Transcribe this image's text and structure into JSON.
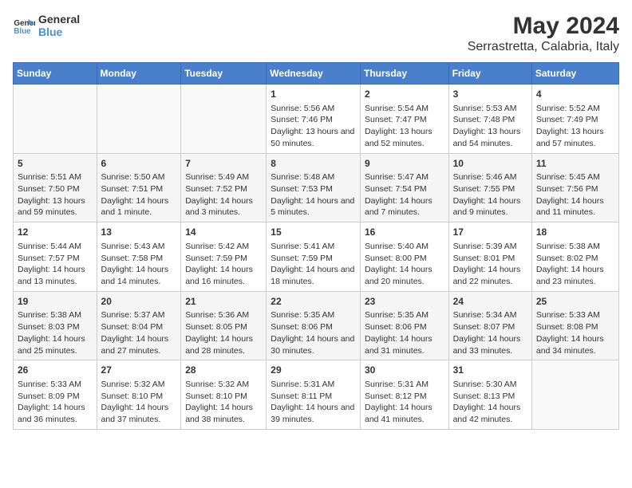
{
  "logo": {
    "line1": "General",
    "line2": "Blue"
  },
  "title": "May 2024",
  "subtitle": "Serrastretta, Calabria, Italy",
  "days_of_week": [
    "Sunday",
    "Monday",
    "Tuesday",
    "Wednesday",
    "Thursday",
    "Friday",
    "Saturday"
  ],
  "weeks": [
    [
      {
        "day": "",
        "sunrise": "",
        "sunset": "",
        "daylight": ""
      },
      {
        "day": "",
        "sunrise": "",
        "sunset": "",
        "daylight": ""
      },
      {
        "day": "",
        "sunrise": "",
        "sunset": "",
        "daylight": ""
      },
      {
        "day": "1",
        "sunrise": "Sunrise: 5:56 AM",
        "sunset": "Sunset: 7:46 PM",
        "daylight": "Daylight: 13 hours and 50 minutes."
      },
      {
        "day": "2",
        "sunrise": "Sunrise: 5:54 AM",
        "sunset": "Sunset: 7:47 PM",
        "daylight": "Daylight: 13 hours and 52 minutes."
      },
      {
        "day": "3",
        "sunrise": "Sunrise: 5:53 AM",
        "sunset": "Sunset: 7:48 PM",
        "daylight": "Daylight: 13 hours and 54 minutes."
      },
      {
        "day": "4",
        "sunrise": "Sunrise: 5:52 AM",
        "sunset": "Sunset: 7:49 PM",
        "daylight": "Daylight: 13 hours and 57 minutes."
      }
    ],
    [
      {
        "day": "5",
        "sunrise": "Sunrise: 5:51 AM",
        "sunset": "Sunset: 7:50 PM",
        "daylight": "Daylight: 13 hours and 59 minutes."
      },
      {
        "day": "6",
        "sunrise": "Sunrise: 5:50 AM",
        "sunset": "Sunset: 7:51 PM",
        "daylight": "Daylight: 14 hours and 1 minute."
      },
      {
        "day": "7",
        "sunrise": "Sunrise: 5:49 AM",
        "sunset": "Sunset: 7:52 PM",
        "daylight": "Daylight: 14 hours and 3 minutes."
      },
      {
        "day": "8",
        "sunrise": "Sunrise: 5:48 AM",
        "sunset": "Sunset: 7:53 PM",
        "daylight": "Daylight: 14 hours and 5 minutes."
      },
      {
        "day": "9",
        "sunrise": "Sunrise: 5:47 AM",
        "sunset": "Sunset: 7:54 PM",
        "daylight": "Daylight: 14 hours and 7 minutes."
      },
      {
        "day": "10",
        "sunrise": "Sunrise: 5:46 AM",
        "sunset": "Sunset: 7:55 PM",
        "daylight": "Daylight: 14 hours and 9 minutes."
      },
      {
        "day": "11",
        "sunrise": "Sunrise: 5:45 AM",
        "sunset": "Sunset: 7:56 PM",
        "daylight": "Daylight: 14 hours and 11 minutes."
      }
    ],
    [
      {
        "day": "12",
        "sunrise": "Sunrise: 5:44 AM",
        "sunset": "Sunset: 7:57 PM",
        "daylight": "Daylight: 14 hours and 13 minutes."
      },
      {
        "day": "13",
        "sunrise": "Sunrise: 5:43 AM",
        "sunset": "Sunset: 7:58 PM",
        "daylight": "Daylight: 14 hours and 14 minutes."
      },
      {
        "day": "14",
        "sunrise": "Sunrise: 5:42 AM",
        "sunset": "Sunset: 7:59 PM",
        "daylight": "Daylight: 14 hours and 16 minutes."
      },
      {
        "day": "15",
        "sunrise": "Sunrise: 5:41 AM",
        "sunset": "Sunset: 7:59 PM",
        "daylight": "Daylight: 14 hours and 18 minutes."
      },
      {
        "day": "16",
        "sunrise": "Sunrise: 5:40 AM",
        "sunset": "Sunset: 8:00 PM",
        "daylight": "Daylight: 14 hours and 20 minutes."
      },
      {
        "day": "17",
        "sunrise": "Sunrise: 5:39 AM",
        "sunset": "Sunset: 8:01 PM",
        "daylight": "Daylight: 14 hours and 22 minutes."
      },
      {
        "day": "18",
        "sunrise": "Sunrise: 5:38 AM",
        "sunset": "Sunset: 8:02 PM",
        "daylight": "Daylight: 14 hours and 23 minutes."
      }
    ],
    [
      {
        "day": "19",
        "sunrise": "Sunrise: 5:38 AM",
        "sunset": "Sunset: 8:03 PM",
        "daylight": "Daylight: 14 hours and 25 minutes."
      },
      {
        "day": "20",
        "sunrise": "Sunrise: 5:37 AM",
        "sunset": "Sunset: 8:04 PM",
        "daylight": "Daylight: 14 hours and 27 minutes."
      },
      {
        "day": "21",
        "sunrise": "Sunrise: 5:36 AM",
        "sunset": "Sunset: 8:05 PM",
        "daylight": "Daylight: 14 hours and 28 minutes."
      },
      {
        "day": "22",
        "sunrise": "Sunrise: 5:35 AM",
        "sunset": "Sunset: 8:06 PM",
        "daylight": "Daylight: 14 hours and 30 minutes."
      },
      {
        "day": "23",
        "sunrise": "Sunrise: 5:35 AM",
        "sunset": "Sunset: 8:06 PM",
        "daylight": "Daylight: 14 hours and 31 minutes."
      },
      {
        "day": "24",
        "sunrise": "Sunrise: 5:34 AM",
        "sunset": "Sunset: 8:07 PM",
        "daylight": "Daylight: 14 hours and 33 minutes."
      },
      {
        "day": "25",
        "sunrise": "Sunrise: 5:33 AM",
        "sunset": "Sunset: 8:08 PM",
        "daylight": "Daylight: 14 hours and 34 minutes."
      }
    ],
    [
      {
        "day": "26",
        "sunrise": "Sunrise: 5:33 AM",
        "sunset": "Sunset: 8:09 PM",
        "daylight": "Daylight: 14 hours and 36 minutes."
      },
      {
        "day": "27",
        "sunrise": "Sunrise: 5:32 AM",
        "sunset": "Sunset: 8:10 PM",
        "daylight": "Daylight: 14 hours and 37 minutes."
      },
      {
        "day": "28",
        "sunrise": "Sunrise: 5:32 AM",
        "sunset": "Sunset: 8:10 PM",
        "daylight": "Daylight: 14 hours and 38 minutes."
      },
      {
        "day": "29",
        "sunrise": "Sunrise: 5:31 AM",
        "sunset": "Sunset: 8:11 PM",
        "daylight": "Daylight: 14 hours and 39 minutes."
      },
      {
        "day": "30",
        "sunrise": "Sunrise: 5:31 AM",
        "sunset": "Sunset: 8:12 PM",
        "daylight": "Daylight: 14 hours and 41 minutes."
      },
      {
        "day": "31",
        "sunrise": "Sunrise: 5:30 AM",
        "sunset": "Sunset: 8:13 PM",
        "daylight": "Daylight: 14 hours and 42 minutes."
      },
      {
        "day": "",
        "sunrise": "",
        "sunset": "",
        "daylight": ""
      }
    ]
  ]
}
